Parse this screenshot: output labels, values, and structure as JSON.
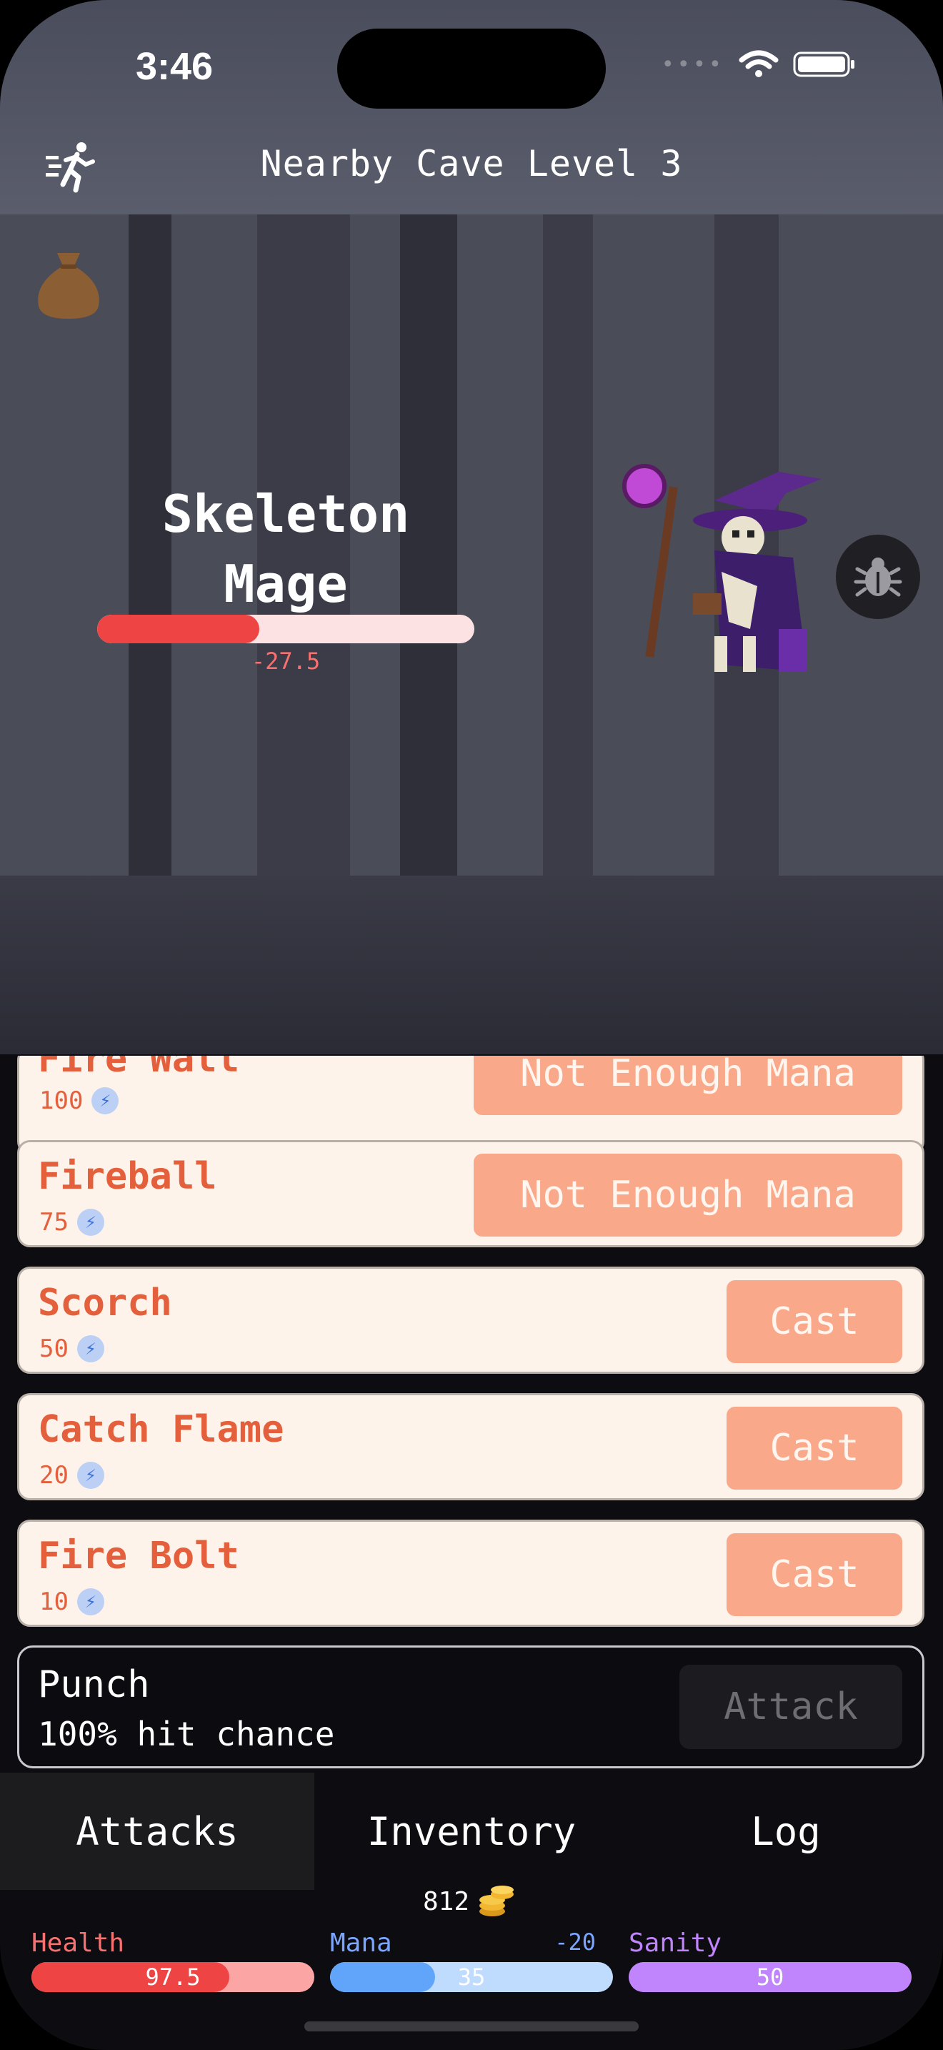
{
  "status": {
    "time": "3:46"
  },
  "header": {
    "title": "Nearby Cave Level 3"
  },
  "enemy": {
    "name": "Skeleton Mage",
    "health_fraction": 0.43,
    "damage_text": "-27.5"
  },
  "spells": [
    {
      "name": "Fire Wall",
      "cost": "100",
      "action": "Not Enough Mana"
    },
    {
      "name": "Fireball",
      "cost": "75",
      "action": "Not Enough Mana"
    },
    {
      "name": "Scorch",
      "cost": "50",
      "action": "Cast"
    },
    {
      "name": "Catch Flame",
      "cost": "20",
      "action": "Cast"
    },
    {
      "name": "Fire Bolt",
      "cost": "10",
      "action": "Cast"
    }
  ],
  "punch": {
    "name": "Punch",
    "hit_chance": "100% hit chance",
    "action": "Attack"
  },
  "tabs": [
    {
      "label": "Attacks",
      "active": true
    },
    {
      "label": "Inventory",
      "active": false
    },
    {
      "label": "Log",
      "active": false
    }
  ],
  "gold": "812",
  "stats": {
    "health": {
      "label": "Health",
      "value": "97.5",
      "fraction": 0.7,
      "color": "#ef4444",
      "track": "#fca5a5",
      "label_color": "#f87171"
    },
    "mana": {
      "label": "Mana",
      "value": "35",
      "delta": "-20",
      "fraction": 0.37,
      "color": "#60a5fa",
      "track": "#bfdbfe",
      "label_color": "#7aa6ff"
    },
    "sanity": {
      "label": "Sanity",
      "value": "50",
      "fraction": 1.0,
      "color": "#c084fc",
      "track": "#c084fc",
      "label_color": "#c084fc"
    }
  },
  "icons": {
    "flee": "running-person-icon",
    "bag": "money-bag-icon",
    "debug": "bug-icon",
    "mana": "bolt-icon",
    "gold": "coin-stack-icon"
  }
}
